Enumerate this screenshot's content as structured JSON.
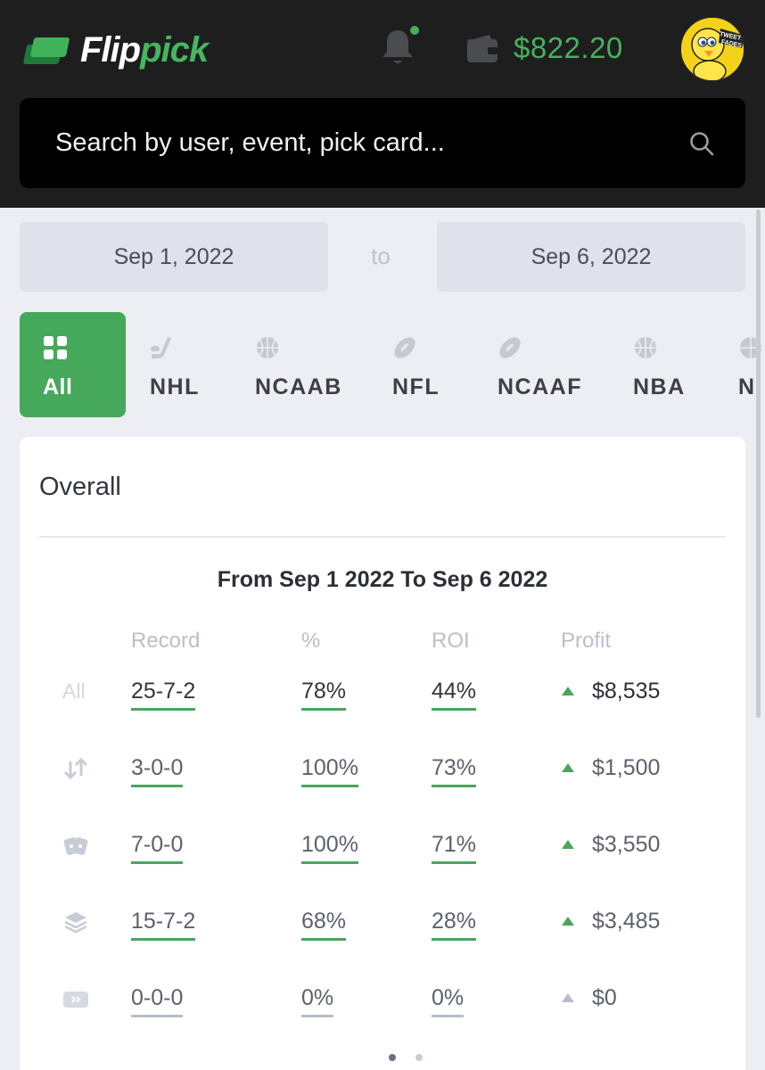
{
  "app": {
    "logo_part1": "Flip",
    "logo_part2": "pick",
    "balance": "$822.20",
    "avatar_label": "TWEETY FADES"
  },
  "search": {
    "placeholder": "Search by user, event, pick card..."
  },
  "dates": {
    "from": "Sep 1, 2022",
    "to_label": "to",
    "to": "Sep 6, 2022"
  },
  "tabs": [
    {
      "label": "All",
      "icon": "grid-icon",
      "active": true
    },
    {
      "label": "NHL",
      "icon": "hockey-stick-icon"
    },
    {
      "label": "NCAAB",
      "icon": "basketball-icon"
    },
    {
      "label": "NFL",
      "icon": "football-icon"
    },
    {
      "label": "NCAAF",
      "icon": "football-icon"
    },
    {
      "label": "NBA",
      "icon": "basketball-icon"
    },
    {
      "label": "N",
      "icon": "basketball-icon"
    }
  ],
  "overall": {
    "title": "Overall",
    "range": "From Sep 1 2022 To Sep 6 2022",
    "headers": {
      "record": "Record",
      "pct": "%",
      "roi": "ROI",
      "profit": "Profit"
    },
    "rows": [
      {
        "label": "All",
        "icon": "",
        "record": "25-7-2",
        "pct": "78%",
        "roi": "44%",
        "profit": "$8,535"
      },
      {
        "label": "",
        "icon": "arrows-up-down-icon",
        "record": "3-0-0",
        "pct": "100%",
        "roi": "73%",
        "profit": "$1,500"
      },
      {
        "label": "",
        "icon": "cards-icon",
        "record": "7-0-0",
        "pct": "100%",
        "roi": "71%",
        "profit": "$3,550"
      },
      {
        "label": "",
        "icon": "layers-icon",
        "record": "15-7-2",
        "pct": "68%",
        "roi": "28%",
        "profit": "$3,485"
      },
      {
        "label": "",
        "icon": "ticket-icon",
        "record": "0-0-0",
        "pct": "0%",
        "roi": "0%",
        "profit": "$0"
      }
    ]
  },
  "colors": {
    "accent": "#45a85a",
    "topbar": "#1e1e1f",
    "background": "#edeef3"
  }
}
